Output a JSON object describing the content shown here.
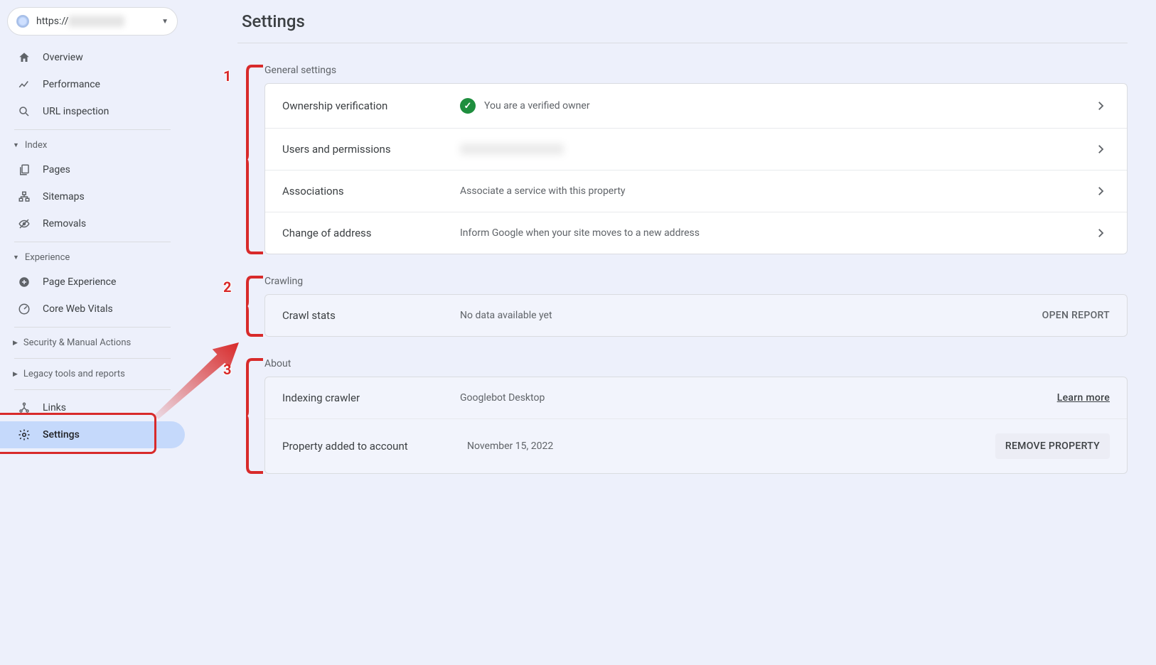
{
  "property_url_prefix": "https://",
  "property_url_blurred": "example site",
  "nav": {
    "overview": "Overview",
    "performance": "Performance",
    "url_inspection": "URL inspection",
    "index_header": "Index",
    "pages": "Pages",
    "sitemaps": "Sitemaps",
    "removals": "Removals",
    "experience_header": "Experience",
    "page_experience": "Page Experience",
    "core_web_vitals": "Core Web Vitals",
    "security_header": "Security & Manual Actions",
    "legacy_header": "Legacy tools and reports",
    "links": "Links",
    "settings": "Settings"
  },
  "page_title": "Settings",
  "annotations": {
    "n1": "1",
    "n2": "2",
    "n3": "3"
  },
  "general": {
    "header": "General settings",
    "ownership": {
      "name": "Ownership verification",
      "value": "You are a verified owner"
    },
    "users": {
      "name": "Users and permissions",
      "value_blurred": "redacted user, redacted"
    },
    "associations": {
      "name": "Associations",
      "value": "Associate a service with this property"
    },
    "address": {
      "name": "Change of address",
      "value": "Inform Google when your site moves to a new address"
    }
  },
  "crawling": {
    "header": "Crawling",
    "crawl_stats": {
      "name": "Crawl stats",
      "value": "No data available yet",
      "action": "OPEN REPORT"
    }
  },
  "about": {
    "header": "About",
    "crawler": {
      "name": "Indexing crawler",
      "value": "Googlebot Desktop",
      "action": "Learn more"
    },
    "added": {
      "name": "Property added to account",
      "value": "November 15, 2022",
      "action": "REMOVE PROPERTY"
    }
  }
}
